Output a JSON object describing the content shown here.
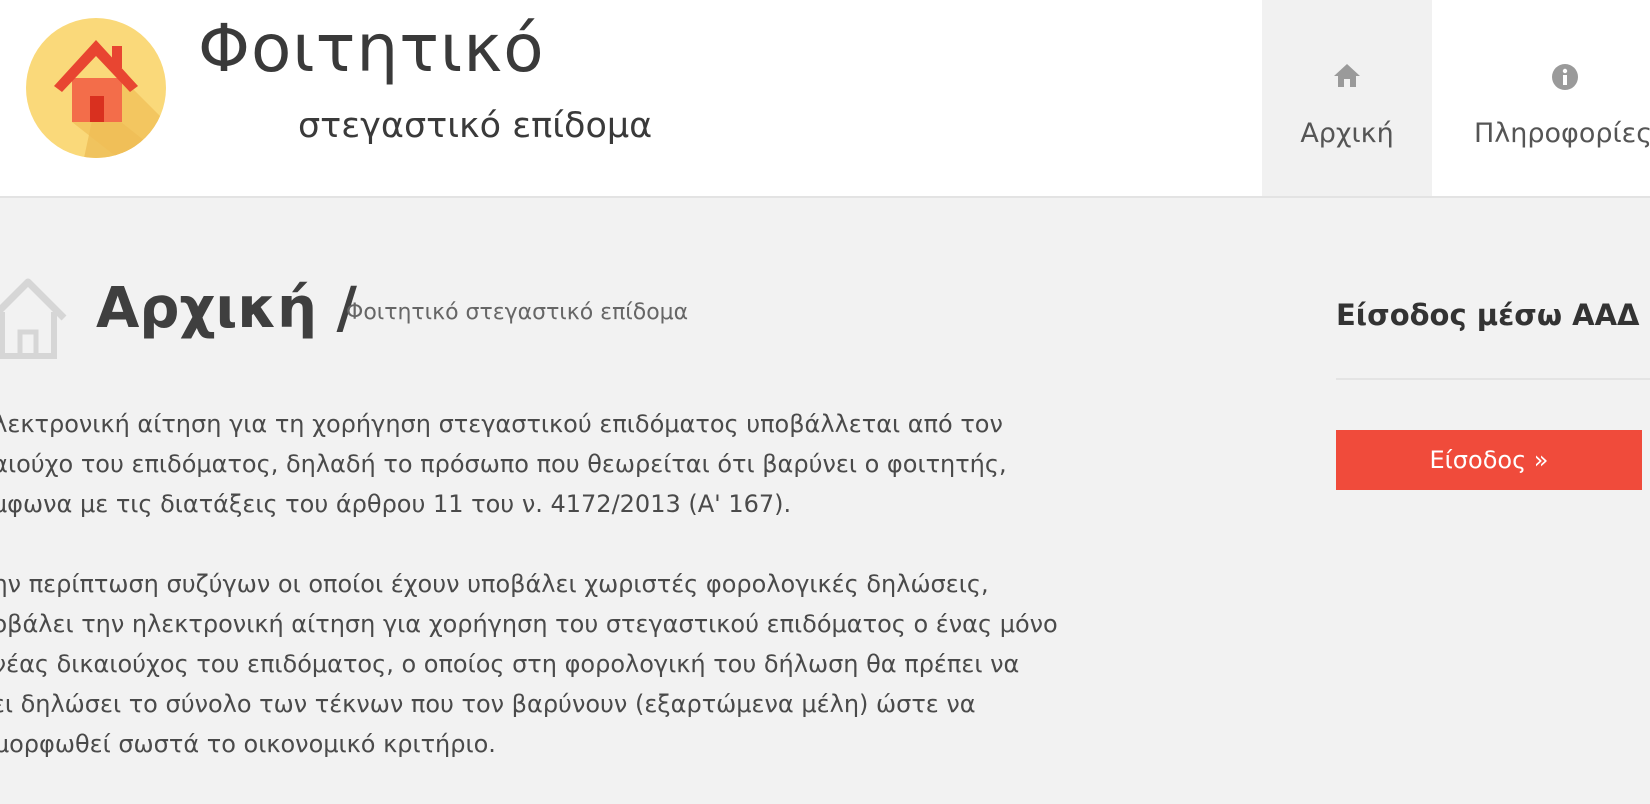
{
  "header": {
    "logo_title": "Φοιτητικό",
    "logo_subtitle": "στεγαστικό επίδομα",
    "logo_icon": "house-icon",
    "nav": [
      {
        "label": "Αρχική",
        "icon": "home-icon"
      },
      {
        "label": "Πληροφορίες",
        "icon": "info-icon"
      }
    ]
  },
  "breadcrumb": {
    "icon": "house-outline-icon",
    "title": "Αρχική /",
    "subtitle": "Φοιτητικό στεγαστικό επίδομα"
  },
  "content": {
    "paragraphs": [
      "ηλεκτρονική αίτηση για τη χορήγηση στεγαστικού επιδόματος υποβάλλεται από τον\nκαιούχο του επιδόματος, δηλαδή το πρόσωπο που θεωρείται ότι βαρύνει ο φοιτητής,\nύμφωνα με τις διατάξεις του άρθρου 11 του ν. 4172/2013 (Α' 167).",
      "την περίπτωση συζύγων οι οποίοι έχουν υποβάλει χωριστές φορολογικές δηλώσεις,\nποβάλει την ηλεκτρονική αίτηση για χορήγηση του στεγαστικού επιδόματος ο ένας μόνο\nονέας δικαιούχος του επιδόματος, ο οποίος στη φορολογική του δήλωση θα πρέπει να\nχει δηλώσει το σύνολο των τέκνων που τον βαρύνουν (εξαρτώμενα μέλη) ώστε να\nαμορφωθεί σωστά το οικονομικό κριτήριο."
    ]
  },
  "sidebar": {
    "title": "Είσοδος μέσω ΑΑΔ",
    "button_label": "Είσοδος »",
    "button_color": "#f04b3b"
  }
}
